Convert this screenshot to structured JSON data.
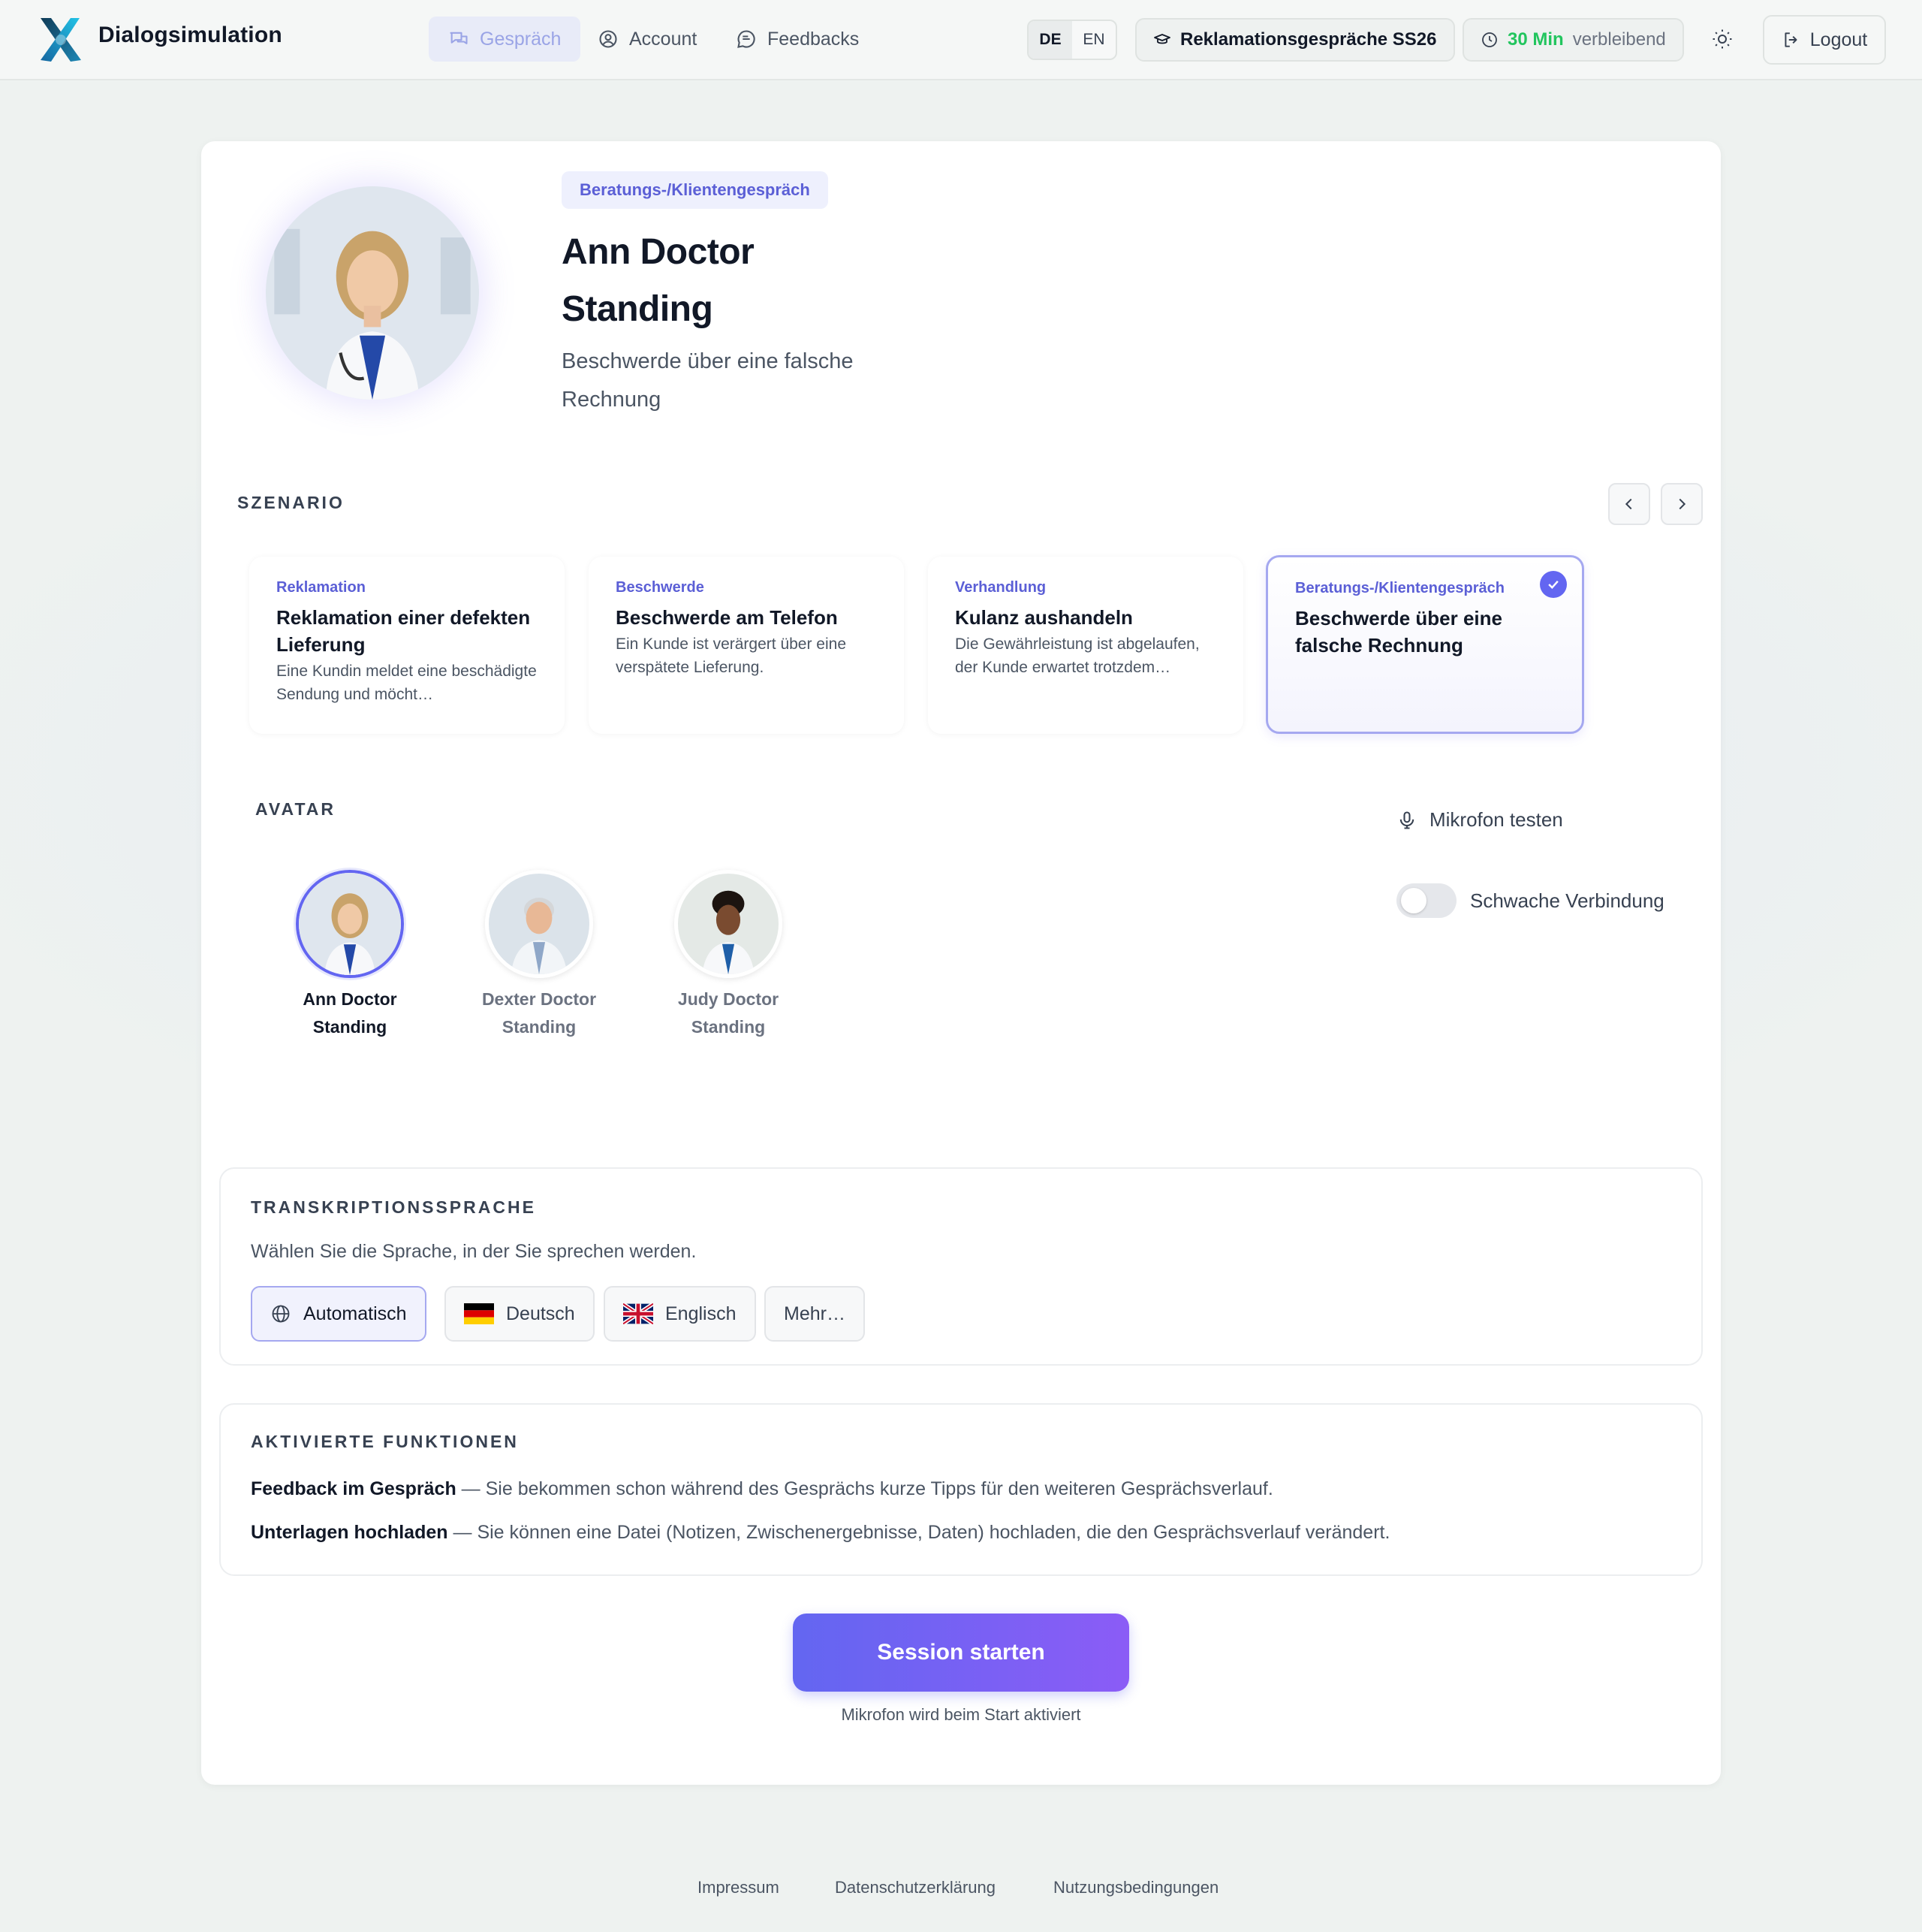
{
  "app": {
    "brand": "Dialogsimulation"
  },
  "nav": {
    "items": [
      {
        "label": "Gespräch",
        "icon": "chat-icon",
        "active": true
      },
      {
        "label": "Account",
        "icon": "user-circle-icon",
        "active": false
      },
      {
        "label": "Feedbacks",
        "icon": "message-icon",
        "active": false
      }
    ]
  },
  "lang_switch": {
    "de": "DE",
    "en": "EN",
    "active": "DE"
  },
  "course": {
    "label": "Reklamationsgespräche SS26",
    "icon": "graduation-cap-icon"
  },
  "timer": {
    "minutes": "30 Min",
    "suffix": "verbleibend",
    "icon": "clock-icon"
  },
  "header": {
    "logout": "Logout"
  },
  "hero": {
    "tag": "Beratungs-/Klientengespräch",
    "title": "Ann Doctor Standing",
    "subtitle": "Beschwerde über eine falsche Rechnung"
  },
  "scenario": {
    "label": "SZENARIO",
    "cards": [
      {
        "category": "Reklamation",
        "title": "Reklamation einer defekten Lieferung",
        "desc": "Eine Kundin meldet eine beschädigte Sendung und möcht…",
        "selected": false
      },
      {
        "category": "Beschwerde",
        "title": "Beschwerde am Telefon",
        "desc": "Ein Kunde ist verärgert über eine verspätete Lieferung.",
        "selected": false
      },
      {
        "category": "Verhandlung",
        "title": "Kulanz aushandeln",
        "desc": "Die Gewährleistung ist abgelaufen, der Kunde erwartet trotzdem…",
        "selected": false
      },
      {
        "category": "Beratungs-/Klientengespräch",
        "title": "Beschwerde über eine falsche Rechnung",
        "desc": "",
        "selected": true
      }
    ]
  },
  "avatar": {
    "label": "AVATAR",
    "options": [
      {
        "name": "Ann Doctor Standing",
        "selected": true
      },
      {
        "name": "Dexter Doctor Standing",
        "selected": false
      },
      {
        "name": "Judy Doctor Standing",
        "selected": false
      }
    ]
  },
  "mic": {
    "test_label": "Mikrofon testen"
  },
  "weak_connection": {
    "label": "Schwache Verbindung",
    "enabled": false
  },
  "transcription": {
    "title": "TRANSKRIPTIONSSPRACHE",
    "text": "Wählen Sie die Sprache, in der Sie sprechen werden.",
    "options": [
      {
        "label": "Automatisch",
        "icon": "globe-icon",
        "selected": true
      },
      {
        "label": "Deutsch",
        "icon": "flag-de-icon",
        "selected": false
      },
      {
        "label": "Englisch",
        "icon": "flag-uk-icon",
        "selected": false
      },
      {
        "label": "Mehr…",
        "icon": "",
        "selected": false
      }
    ]
  },
  "features": {
    "title": "AKTIVIERTE FUNKTIONEN",
    "items": [
      {
        "name": "Feedback im Gespräch",
        "desc": " — Sie bekommen schon während des Gesprächs kurze Tipps für den weiteren Gesprächsverlauf."
      },
      {
        "name": "Unterlagen hochladen",
        "desc": " — Sie können eine Datei (Notizen, Zwischenergebnisse, Daten) hochladen, die den Gesprächsverlauf verändert."
      }
    ]
  },
  "start": {
    "button": "Session starten",
    "hint": "Mikrofon wird beim Start aktiviert"
  },
  "footer": {
    "links": [
      "Impressum",
      "Datenschutzerklärung",
      "Nutzungsbedingungen"
    ]
  },
  "colors": {
    "accent": "#6366f1",
    "accent2": "#8b5cf6",
    "timer_green": "#22c55e"
  }
}
